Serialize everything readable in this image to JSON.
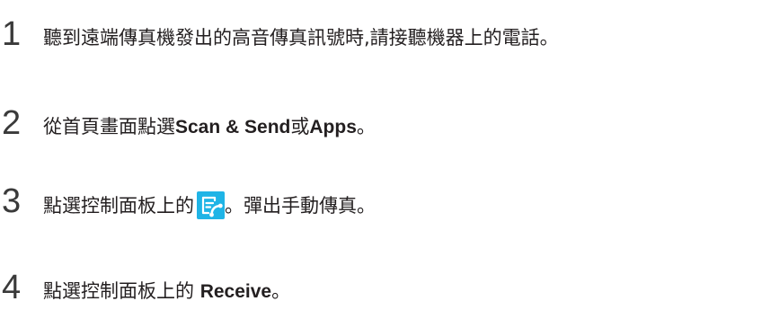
{
  "steps": [
    {
      "number": "1",
      "text": "聽到遠端傳真機發出的高音傳真訊號時,請接聽機器上的電話。"
    },
    {
      "number": "2",
      "prefix": "從首頁畫面點選",
      "bold1": "Scan & Send",
      "middle": "或",
      "bold2": "Apps",
      "suffix": "。"
    },
    {
      "number": "3",
      "prefix": "點選控制面板上的",
      "icon": "manual-fax-icon",
      "suffix": "。彈出手動傳真。"
    },
    {
      "number": "4",
      "prefix": "點選控制面板上的 ",
      "bold": "Receive",
      "suffix": "。"
    }
  ],
  "colors": {
    "text": "#231f20",
    "number": "#3a3a3a",
    "icon_bg": "#1fb4e6",
    "icon_fg": "#ffffff"
  }
}
